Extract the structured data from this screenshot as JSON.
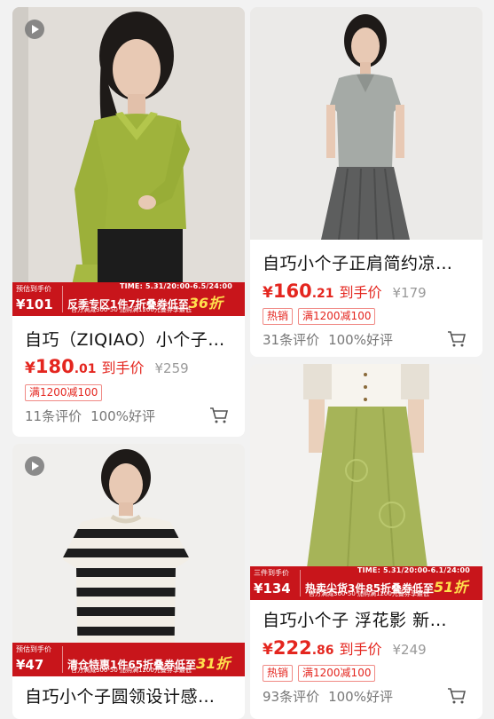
{
  "products": [
    {
      "title": "自巧（ZIQIAO）小个子…",
      "price_currency": "¥",
      "price_int": "180",
      "price_dec": ".01",
      "price_label": "到手价",
      "original_price": "¥259",
      "tags": [
        "满1200减100"
      ],
      "reviews": "11条评价",
      "rating": "100%好评",
      "has_video": true,
      "banner": {
        "left_label": "预估到手价",
        "price": "¥101",
        "time": "TIME: 5.31/20:00-6.5/24:00",
        "headline_pre": "反季专区1件7折叠券低至",
        "headline_em": "36折",
        "sub": "官方满减300-50 加购满1200元叠券享最低"
      }
    },
    {
      "title": "自巧小个子正肩简约凉…",
      "price_currency": "¥",
      "price_int": "160",
      "price_dec": ".21",
      "price_label": "到手价",
      "original_price": "¥179",
      "tags": [
        "热销",
        "满1200减100"
      ],
      "reviews": "31条评价",
      "rating": "100%好评",
      "has_video": false
    },
    {
      "title": "自巧小个子圆领设计感…",
      "has_video": true,
      "banner": {
        "left_label": "预估到手价",
        "price": "¥47",
        "time": "",
        "headline_pre": "清仓特惠1件65折叠券低至",
        "headline_em": "31折",
        "sub": "官方满减300-50 加购满1200元叠券享最低"
      }
    },
    {
      "title": "自巧小个子 浮花影 新…",
      "price_currency": "¥",
      "price_int": "222",
      "price_dec": ".86",
      "price_label": "到手价",
      "original_price": "¥249",
      "tags": [
        "热销",
        "满1200减100"
      ],
      "reviews": "93条评价",
      "rating": "100%好评",
      "has_video": false,
      "banner": {
        "left_label": "三件到手价",
        "price": "¥134",
        "time": "TIME: 5.31/20:00-6.1/24:00",
        "headline_pre": "热卖尖货3件85折叠券低至",
        "headline_em": "51折",
        "sub": "官方满减300-50 加购满1200元叠券享最低"
      }
    }
  ],
  "colors": {
    "accent": "#e4261f",
    "banner_red": "#c8151b",
    "background": "#f2f2f2"
  },
  "icons": {
    "cart": "cart-icon",
    "video": "play-icon"
  }
}
